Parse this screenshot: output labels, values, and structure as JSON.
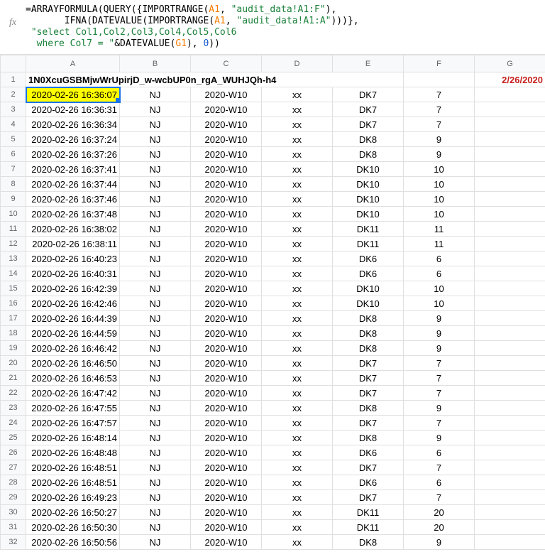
{
  "formula_bar": {
    "fx_label": "fx",
    "line1_prefix": "=ARRAYFORMULA(QUERY({IMPORTRANGE(",
    "line1_ref": "A1",
    "line1_mid": ", ",
    "line1_str": "\"audit_data!A1:F\"",
    "line1_suffix": "),",
    "line2_prefix": "       IFNA(DATEVALUE(IMPORTRANGE(",
    "line2_ref": "A1",
    "line2_mid": ", ",
    "line2_str": "\"audit_data!A1:A\"",
    "line2_suffix": ")))},",
    "line3": " \"select Col1,Col2,Col3,Col4,Col5,Col6",
    "line4_prefix": "  where Col7 = \"",
    "line4_mid": "&DATEVALUE(",
    "line4_ref": "G1",
    "line4_mid2": "), ",
    "line4_num": "0",
    "line4_suffix": "))"
  },
  "columns": [
    "A",
    "B",
    "C",
    "D",
    "E",
    "F",
    "G"
  ],
  "header_row": {
    "row_num": "1",
    "a1_text": "1N0XcuGSBMjwWrUpirjD_w-wcbUP0n_rgA_WUHJQh-h4",
    "g1_text": "2/26/2020"
  },
  "rows": [
    {
      "n": "2",
      "a": "2020-02-26 16:36:07",
      "b": "NJ",
      "c": "2020-W10",
      "d": "xx",
      "e": "DK7",
      "f": "7",
      "active": true
    },
    {
      "n": "3",
      "a": "2020-02-26 16:36:31",
      "b": "NJ",
      "c": "2020-W10",
      "d": "xx",
      "e": "DK7",
      "f": "7"
    },
    {
      "n": "4",
      "a": "2020-02-26 16:36:34",
      "b": "NJ",
      "c": "2020-W10",
      "d": "xx",
      "e": "DK7",
      "f": "7"
    },
    {
      "n": "5",
      "a": "2020-02-26 16:37:24",
      "b": "NJ",
      "c": "2020-W10",
      "d": "xx",
      "e": "DK8",
      "f": "9"
    },
    {
      "n": "6",
      "a": "2020-02-26 16:37:26",
      "b": "NJ",
      "c": "2020-W10",
      "d": "xx",
      "e": "DK8",
      "f": "9"
    },
    {
      "n": "7",
      "a": "2020-02-26 16:37:41",
      "b": "NJ",
      "c": "2020-W10",
      "d": "xx",
      "e": "DK10",
      "f": "10"
    },
    {
      "n": "8",
      "a": "2020-02-26 16:37:44",
      "b": "NJ",
      "c": "2020-W10",
      "d": "xx",
      "e": "DK10",
      "f": "10"
    },
    {
      "n": "9",
      "a": "2020-02-26 16:37:46",
      "b": "NJ",
      "c": "2020-W10",
      "d": "xx",
      "e": "DK10",
      "f": "10"
    },
    {
      "n": "10",
      "a": "2020-02-26 16:37:48",
      "b": "NJ",
      "c": "2020-W10",
      "d": "xx",
      "e": "DK10",
      "f": "10"
    },
    {
      "n": "11",
      "a": "2020-02-26 16:38:02",
      "b": "NJ",
      "c": "2020-W10",
      "d": "xx",
      "e": "DK11",
      "f": "11"
    },
    {
      "n": "12",
      "a": "2020-02-26 16:38:11",
      "b": "NJ",
      "c": "2020-W10",
      "d": "xx",
      "e": "DK11",
      "f": "11"
    },
    {
      "n": "13",
      "a": "2020-02-26 16:40:23",
      "b": "NJ",
      "c": "2020-W10",
      "d": "xx",
      "e": "DK6",
      "f": "6"
    },
    {
      "n": "14",
      "a": "2020-02-26 16:40:31",
      "b": "NJ",
      "c": "2020-W10",
      "d": "xx",
      "e": "DK6",
      "f": "6"
    },
    {
      "n": "15",
      "a": "2020-02-26 16:42:39",
      "b": "NJ",
      "c": "2020-W10",
      "d": "xx",
      "e": "DK10",
      "f": "10"
    },
    {
      "n": "16",
      "a": "2020-02-26 16:42:46",
      "b": "NJ",
      "c": "2020-W10",
      "d": "xx",
      "e": "DK10",
      "f": "10"
    },
    {
      "n": "17",
      "a": "2020-02-26 16:44:39",
      "b": "NJ",
      "c": "2020-W10",
      "d": "xx",
      "e": "DK8",
      "f": "9"
    },
    {
      "n": "18",
      "a": "2020-02-26 16:44:59",
      "b": "NJ",
      "c": "2020-W10",
      "d": "xx",
      "e": "DK8",
      "f": "9"
    },
    {
      "n": "19",
      "a": "2020-02-26 16:46:42",
      "b": "NJ",
      "c": "2020-W10",
      "d": "xx",
      "e": "DK8",
      "f": "9"
    },
    {
      "n": "20",
      "a": "2020-02-26 16:46:50",
      "b": "NJ",
      "c": "2020-W10",
      "d": "xx",
      "e": "DK7",
      "f": "7"
    },
    {
      "n": "21",
      "a": "2020-02-26 16:46:53",
      "b": "NJ",
      "c": "2020-W10",
      "d": "xx",
      "e": "DK7",
      "f": "7"
    },
    {
      "n": "22",
      "a": "2020-02-26 16:47:42",
      "b": "NJ",
      "c": "2020-W10",
      "d": "xx",
      "e": "DK7",
      "f": "7"
    },
    {
      "n": "23",
      "a": "2020-02-26 16:47:55",
      "b": "NJ",
      "c": "2020-W10",
      "d": "xx",
      "e": "DK8",
      "f": "9"
    },
    {
      "n": "24",
      "a": "2020-02-26 16:47:57",
      "b": "NJ",
      "c": "2020-W10",
      "d": "xx",
      "e": "DK7",
      "f": "7"
    },
    {
      "n": "25",
      "a": "2020-02-26 16:48:14",
      "b": "NJ",
      "c": "2020-W10",
      "d": "xx",
      "e": "DK8",
      "f": "9"
    },
    {
      "n": "26",
      "a": "2020-02-26 16:48:48",
      "b": "NJ",
      "c": "2020-W10",
      "d": "xx",
      "e": "DK6",
      "f": "6"
    },
    {
      "n": "27",
      "a": "2020-02-26 16:48:51",
      "b": "NJ",
      "c": "2020-W10",
      "d": "xx",
      "e": "DK7",
      "f": "7"
    },
    {
      "n": "28",
      "a": "2020-02-26 16:48:51",
      "b": "NJ",
      "c": "2020-W10",
      "d": "xx",
      "e": "DK6",
      "f": "6"
    },
    {
      "n": "29",
      "a": "2020-02-26 16:49:23",
      "b": "NJ",
      "c": "2020-W10",
      "d": "xx",
      "e": "DK7",
      "f": "7"
    },
    {
      "n": "30",
      "a": "2020-02-26 16:50:27",
      "b": "NJ",
      "c": "2020-W10",
      "d": "xx",
      "e": "DK11",
      "f": "20"
    },
    {
      "n": "31",
      "a": "2020-02-26 16:50:30",
      "b": "NJ",
      "c": "2020-W10",
      "d": "xx",
      "e": "DK11",
      "f": "20"
    },
    {
      "n": "32",
      "a": "2020-02-26 16:50:56",
      "b": "NJ",
      "c": "2020-W10",
      "d": "xx",
      "e": "DK8",
      "f": "9"
    }
  ]
}
